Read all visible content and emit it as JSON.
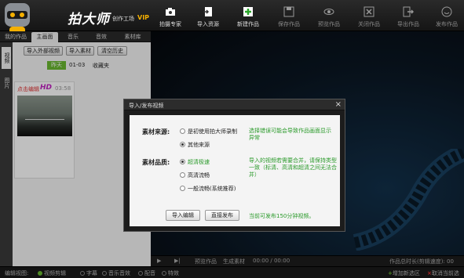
{
  "app": {
    "brand": "拍大师",
    "sub": "创作工场",
    "vip": "VIP"
  },
  "toolbar": [
    {
      "label": "拍摄专家",
      "icon": "camera-icon",
      "dim": false
    },
    {
      "label": "导入资源",
      "icon": "import-icon",
      "dim": false
    },
    {
      "label": "新建作品",
      "icon": "new-icon",
      "dim": false
    },
    {
      "label": "保存作品",
      "icon": "save-icon",
      "dim": true
    },
    {
      "label": "预览作品",
      "icon": "eye-icon",
      "dim": true
    },
    {
      "label": "关闭作品",
      "icon": "close-doc-icon",
      "dim": true
    },
    {
      "label": "导出作品",
      "icon": "export-icon",
      "dim": true
    },
    {
      "label": "发布作品",
      "icon": "smile-icon",
      "dim": true
    }
  ],
  "tabs": [
    "我的作品",
    "主画面",
    "音乐",
    "音效",
    "素材库"
  ],
  "vtabs": [
    "视频",
    "图片"
  ],
  "left_buttons": [
    "导入外部视频",
    "导入素材",
    "清空历史"
  ],
  "list": {
    "today": "昨天",
    "date": "01-03",
    "fold": "收藏夹"
  },
  "thumb": {
    "edit": "点击编辑",
    "hd": "HD",
    "time": "03:58"
  },
  "dialog": {
    "title": "导入/发布视频",
    "source_label": "素材来源:",
    "source_opt1": "是初使用拍大师录制",
    "source_opt2": "其他来源",
    "source_note": "选择错误可能会导致作品画面显示异常",
    "quality_label": "素材品质:",
    "quality_opt1": "超清极速",
    "quality_opt2": "高清流畅",
    "quality_opt3": "一般流畅(系统推荐)",
    "quality_note": "导入的视频若需要合并，请保持类型一致（标清、高清和超清之间无法合并）",
    "btn_import": "导入编辑",
    "btn_publish": "直接发布",
    "bottom_note": "当前可发布150分钟视频。"
  },
  "controls": {
    "preview": "预览作品",
    "gen": "生成素材",
    "time": "00:00 / 00:00",
    "total": "作品总时长(剪辑速度): 00"
  },
  "footer": {
    "edit_view": "编辑视图:",
    "video_edit": "视频剪辑",
    "subtitle": "字幕",
    "music_fx": "音乐音效",
    "dubbing": "配音",
    "effects": "特效",
    "add_new": "增加新选区",
    "cancel_sel": "取消当前选区"
  }
}
